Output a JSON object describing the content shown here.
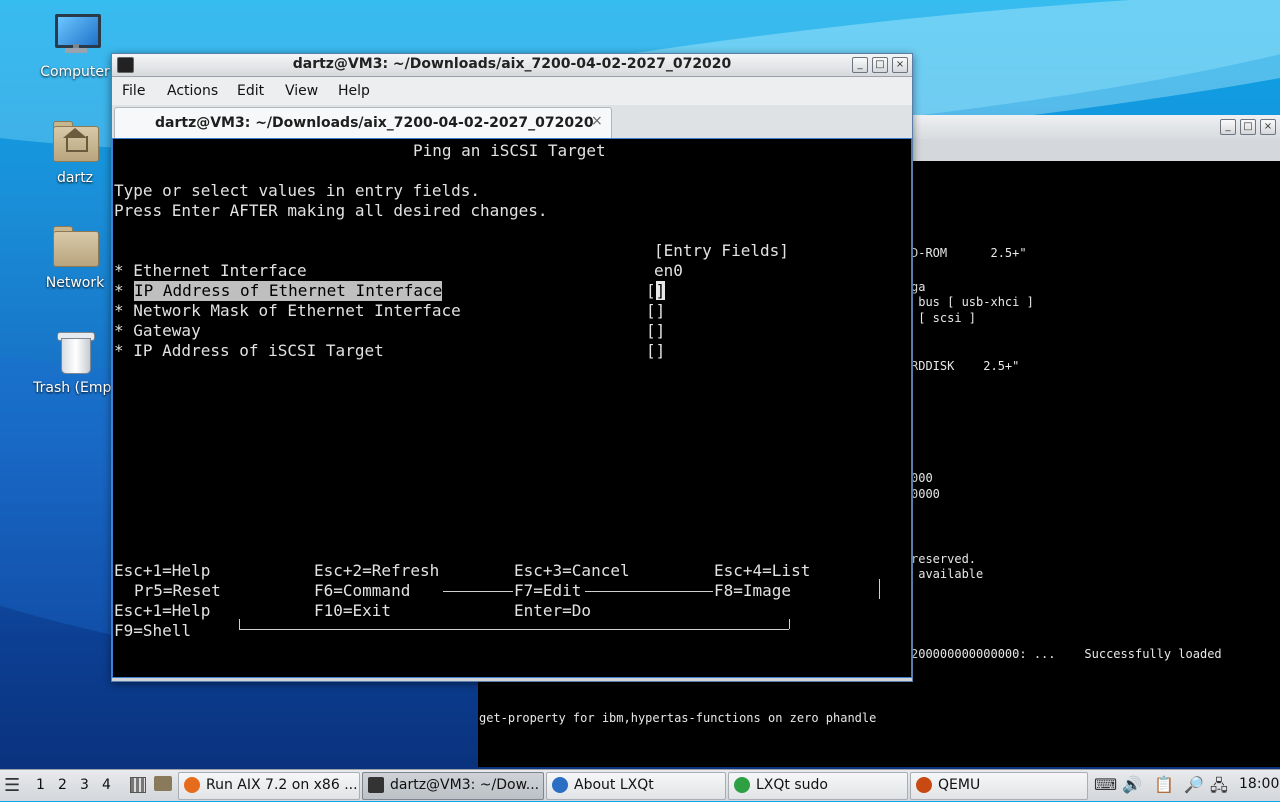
{
  "desktop": {
    "icons": [
      {
        "label": "Computer"
      },
      {
        "label": "dartz"
      },
      {
        "label": "Network"
      },
      {
        "label": "Trash (Empt"
      }
    ]
  },
  "background_window": {
    "lines": [
      "D-ROM      2.5+\"",
      "ga",
      " bus [ usb-xhci ]",
      " [ scsi ]",
      "RDDISK    2.5+\"",
      "000",
      "0000",
      "reserved.",
      " available",
      "200000000000000: ...    Successfully loaded",
      "get-property for ibm,hypertas-functions on zero phandle"
    ]
  },
  "terminal_window": {
    "title": "dartz@VM3: ~/Downloads/aix_7200-04-02-2027_072020",
    "menu": [
      "File",
      "Actions",
      "Edit",
      "View",
      "Help"
    ],
    "tab_label": "dartz@VM3: ~/Downloads/aix_7200-04-02-2027_072020",
    "tab_close": "×"
  },
  "smit": {
    "heading": "Ping an iSCSI Target",
    "instructions": [
      "Type or select values in entry fields.",
      "Press Enter AFTER making all desired changes."
    ],
    "entry_header": "[Entry Fields]",
    "fields": [
      {
        "label": "* Ethernet Interface",
        "value": "en0"
      },
      {
        "label": "IP Address of Ethernet Interface",
        "value": "[]"
      },
      {
        "label": "* Network Mask of Ethernet Interface",
        "value": "[]"
      },
      {
        "label": "* Gateway",
        "value": "[]"
      },
      {
        "label": "* IP Address of iSCSI Target",
        "value": "[]"
      }
    ],
    "keys": {
      "row1": [
        "Esc+1=Help",
        "Esc+2=Refresh",
        "Esc+3=Cancel",
        "Esc+4=List"
      ],
      "row2": [
        "Pr5=Reset",
        "F6=Command",
        "F7=Edit",
        "F8=Image"
      ],
      "row3": [
        "Esc+1=Help",
        "F10=Exit",
        "Enter=Do"
      ],
      "row4": [
        "F9=Shell"
      ]
    }
  },
  "taskbar": {
    "workspaces": [
      "1",
      "2",
      "3",
      "4"
    ],
    "tasks": [
      {
        "label": "Run AIX 7.2 on x86 ...",
        "icon_color": "#e66b1c"
      },
      {
        "label": "dartz@VM3: ~/Dow...",
        "icon_color": "#333333"
      },
      {
        "label": "About LXQt",
        "icon_color": "#2a6fc4"
      },
      {
        "label": "LXQt sudo",
        "icon_color": "#2ea043"
      },
      {
        "label": "QEMU",
        "icon_color": "#c84a12"
      }
    ],
    "clock": "18:00"
  }
}
